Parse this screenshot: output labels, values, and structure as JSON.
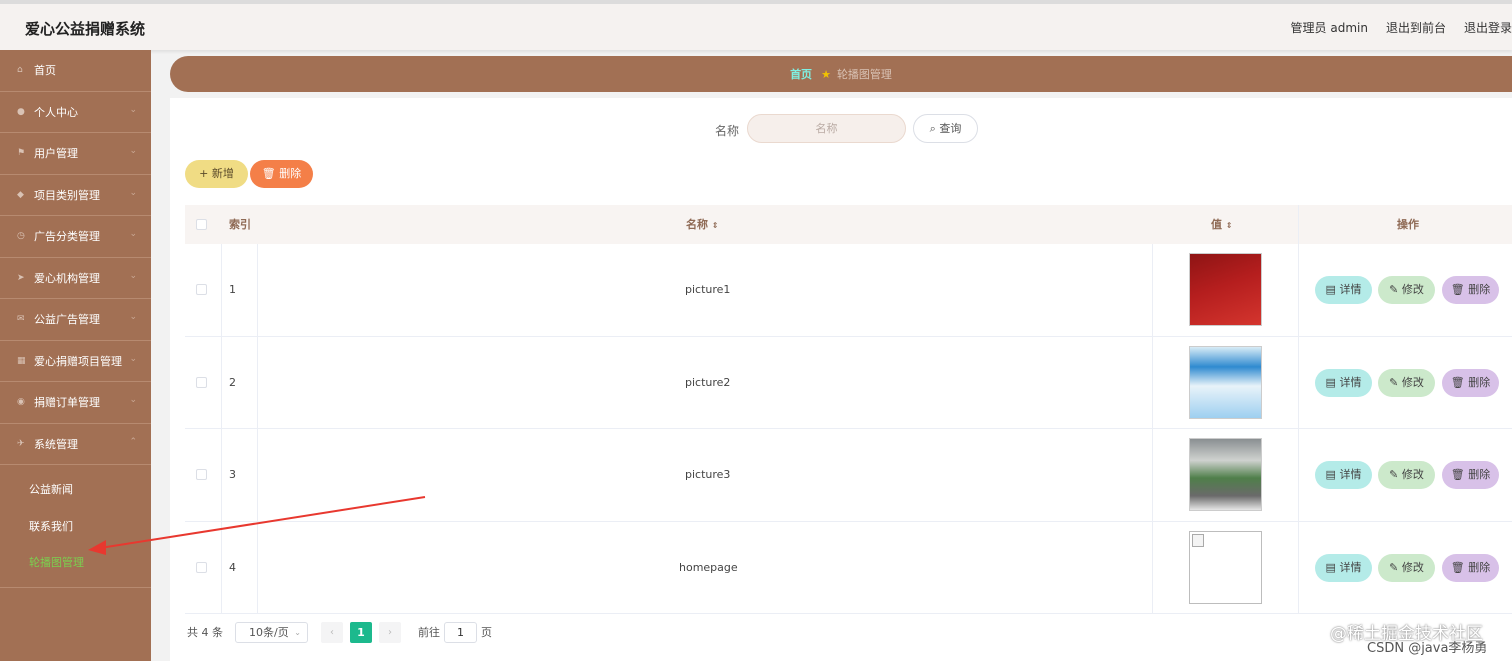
{
  "app": {
    "title": "爱心公益捐赠系统"
  },
  "topbar": {
    "user": "管理员 admin",
    "to_front": "退出到前台",
    "logout": "退出登录"
  },
  "sidebar": {
    "items": [
      {
        "label": "首页",
        "icon": "home-icon"
      },
      {
        "label": "个人中心",
        "icon": "user-icon"
      },
      {
        "label": "用户管理",
        "icon": "flag-icon"
      },
      {
        "label": "项目类别管理",
        "icon": "shield-icon"
      },
      {
        "label": "广告分类管理",
        "icon": "clock-icon"
      },
      {
        "label": "爱心机构管理",
        "icon": "send-icon"
      },
      {
        "label": "公益广告管理",
        "icon": "mail-icon"
      },
      {
        "label": "爱心捐赠项目管理",
        "icon": "grid-icon"
      },
      {
        "label": "捐赠订单管理",
        "icon": "location-icon"
      },
      {
        "label": "系统管理",
        "icon": "rocket-icon"
      }
    ],
    "sub_items": [
      {
        "label": "公益新闻",
        "active": false
      },
      {
        "label": "联系我们",
        "active": false
      },
      {
        "label": "轮播图管理",
        "active": true
      }
    ]
  },
  "breadcrumb": {
    "home": "首页",
    "current": "轮播图管理"
  },
  "search": {
    "label": "名称",
    "placeholder": "名称",
    "button": "查询"
  },
  "actions": {
    "add": "新增",
    "delete": "删除"
  },
  "table": {
    "columns": {
      "index": "索引",
      "name": "名称",
      "value": "值",
      "ops": "操作"
    },
    "rows": [
      {
        "index": "1",
        "name": "picture1"
      },
      {
        "index": "2",
        "name": "picture2"
      },
      {
        "index": "3",
        "name": "picture3"
      },
      {
        "index": "4",
        "name": "homepage"
      }
    ],
    "op_labels": {
      "detail": "详情",
      "edit": "修改",
      "remove": "删除"
    }
  },
  "pagination": {
    "total": "共 4 条",
    "page_size": "10条/页",
    "current": "1",
    "goto_prefix": "前往",
    "goto_value": "1",
    "goto_suffix": "页"
  },
  "watermark": {
    "line1": "@稀土掘金技术社区",
    "line2": "CSDN @java李杨勇"
  },
  "colors": {
    "sidebar": "#a27054",
    "active_sub": "#7bd04f",
    "page_active": "#1cb98d"
  }
}
